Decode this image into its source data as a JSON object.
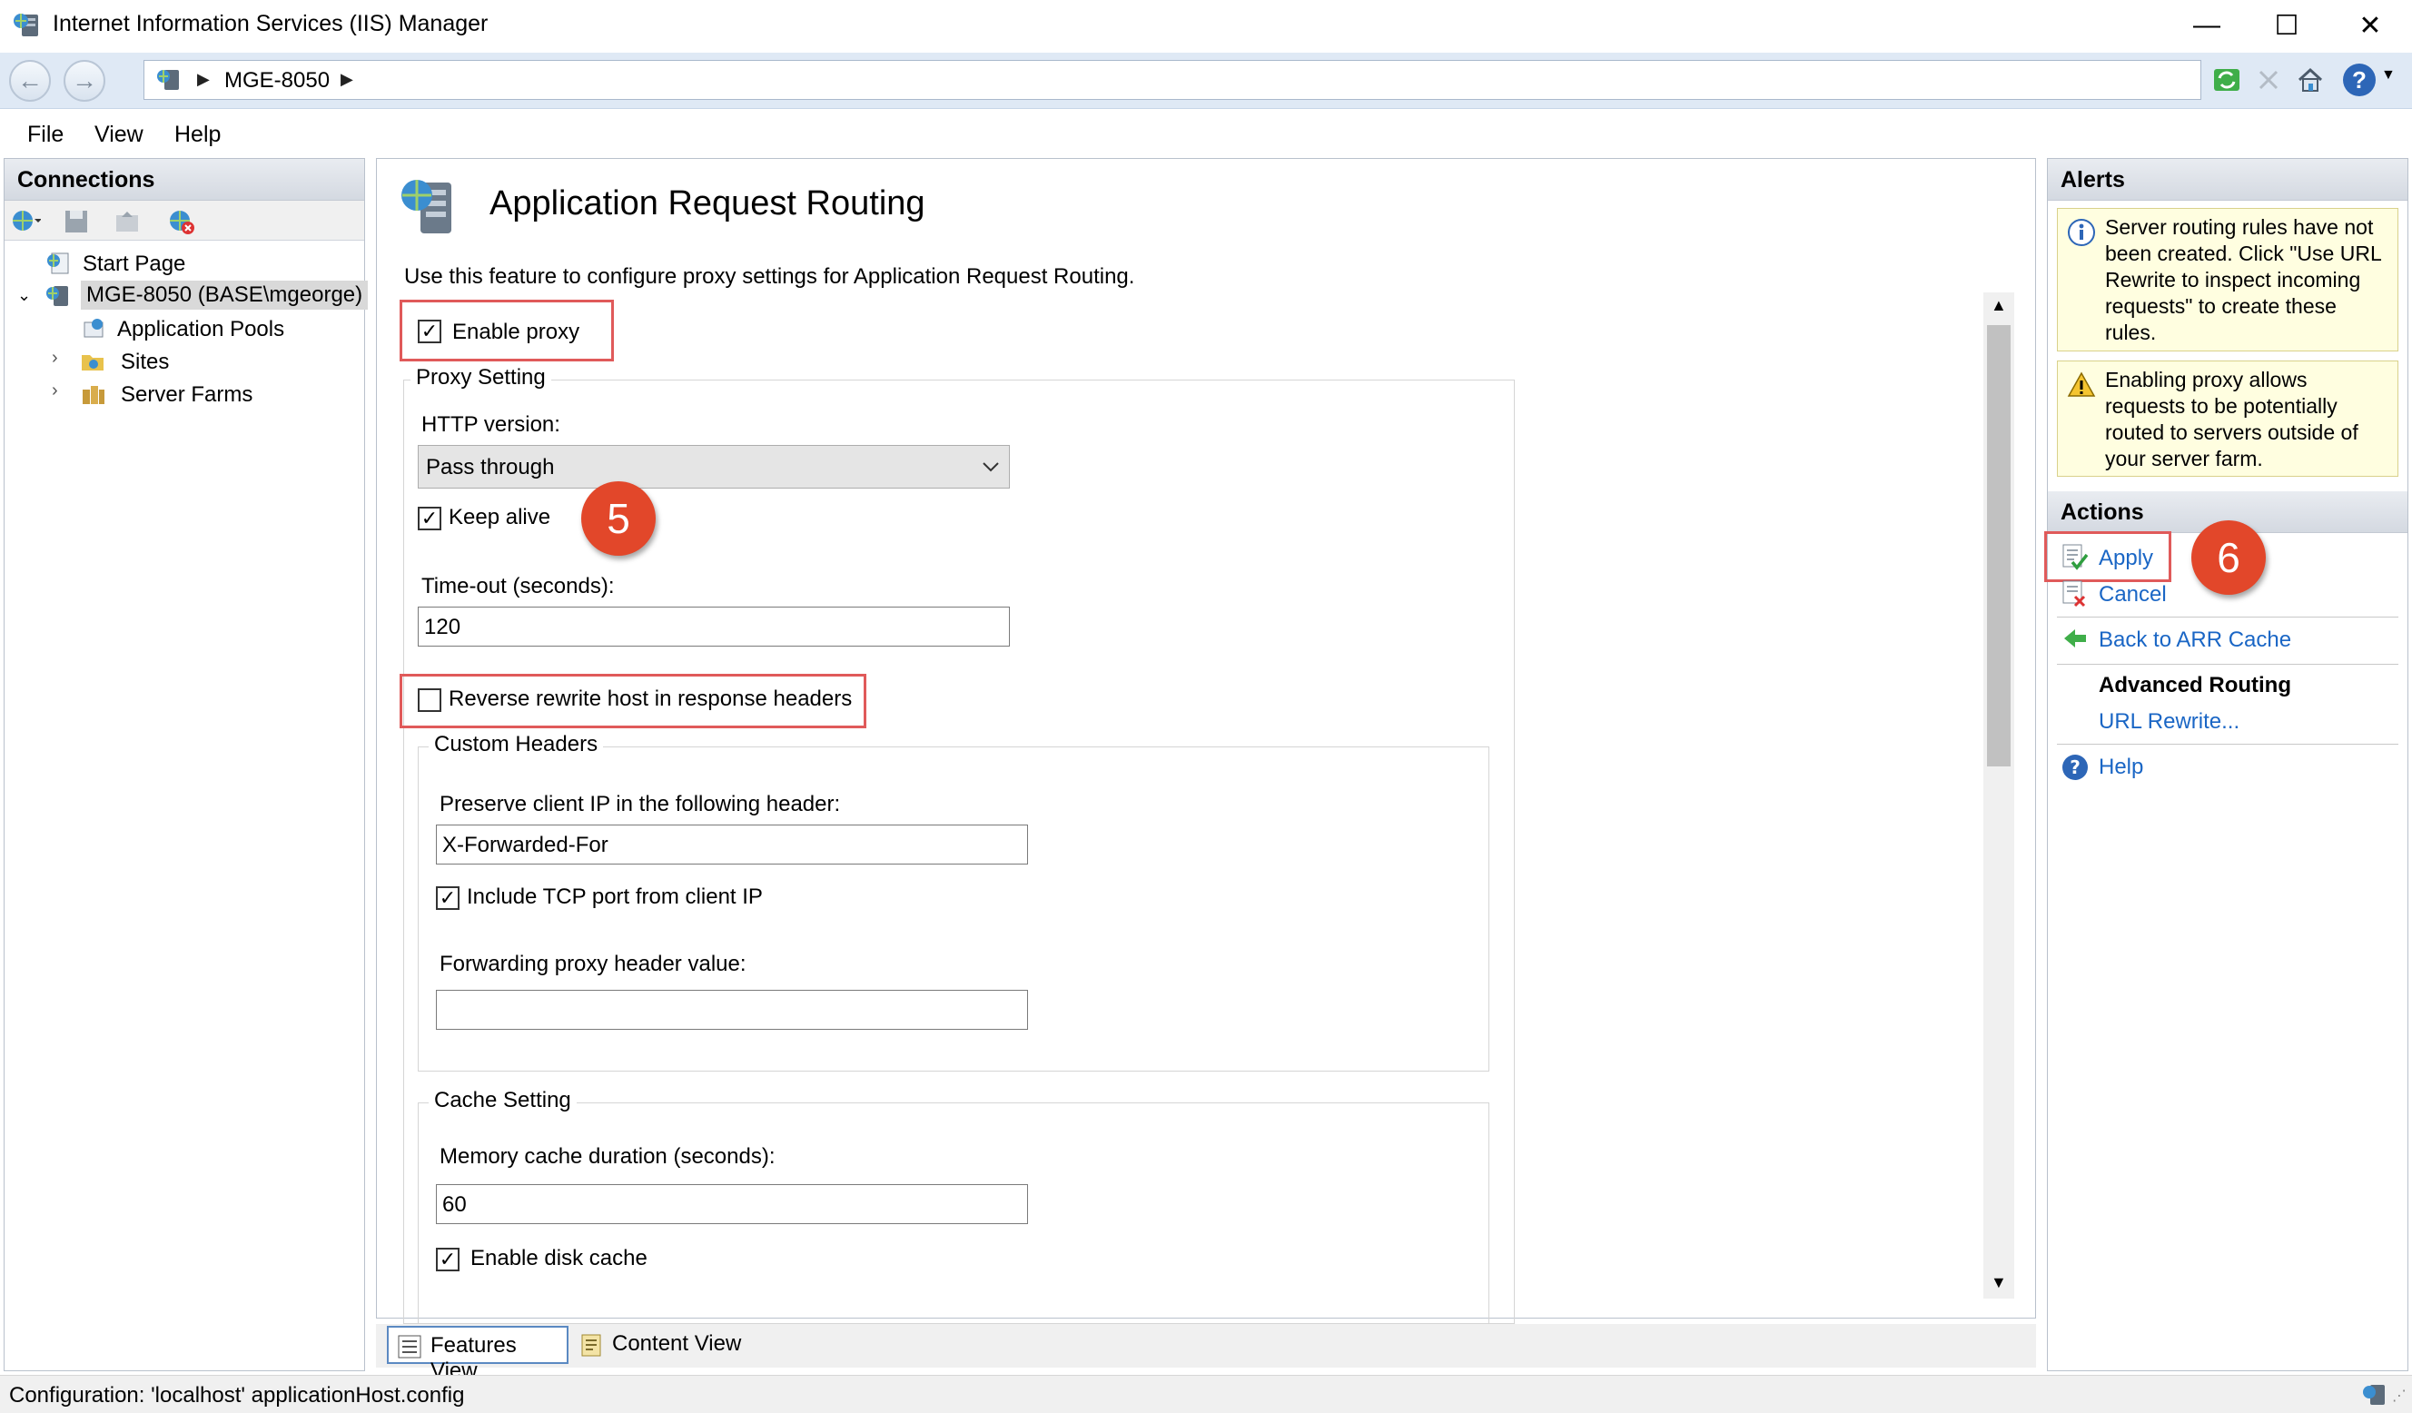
{
  "window": {
    "title": "Internet Information Services (IIS) Manager",
    "controls": {
      "minimize": "—",
      "maximize": "☐",
      "close": "✕"
    }
  },
  "address": {
    "back": "←",
    "forward": "→",
    "path": "MGE-8050",
    "separator": "▶",
    "help": "?"
  },
  "menu": [
    "File",
    "View",
    "Help"
  ],
  "connections": {
    "title": "Connections",
    "tree": [
      {
        "label": "Start Page"
      },
      {
        "label": "MGE-8050 (BASE\\mgeorge)"
      },
      {
        "label": "Application Pools"
      },
      {
        "label": "Sites"
      },
      {
        "label": "Server Farms"
      }
    ]
  },
  "feature": {
    "title": "Application Request Routing",
    "description": "Use this feature to configure proxy settings for Application Request Routing.",
    "enable_proxy": {
      "label": "Enable proxy",
      "checked": true
    },
    "proxy_setting": {
      "title": "Proxy Setting",
      "http_version_label": "HTTP version:",
      "http_version_value": "Pass through",
      "keep_alive": {
        "label": "Keep alive",
        "checked": true
      },
      "timeout_label": "Time-out (seconds):",
      "timeout_value": "120",
      "reverse_rewrite": {
        "label": "Reverse rewrite host in response headers",
        "checked": false
      }
    },
    "custom_headers": {
      "title": "Custom Headers",
      "preserve_ip_label": "Preserve client IP in the following header:",
      "preserve_ip_value": "X-Forwarded-For",
      "include_tcp": {
        "label": "Include TCP port from client IP",
        "checked": true
      },
      "forwarding_label": "Forwarding proxy header value:",
      "forwarding_value": ""
    },
    "cache_setting": {
      "title": "Cache Setting",
      "memory_label": "Memory cache duration (seconds):",
      "memory_value": "60",
      "disk_cache": {
        "label": "Enable disk cache",
        "checked": true
      }
    },
    "badges": {
      "step5": "5",
      "step6": "6"
    }
  },
  "view_tabs": {
    "features": "Features View",
    "content": "Content View"
  },
  "alerts": {
    "title": "Alerts",
    "items": [
      {
        "type": "info",
        "text": "Server routing rules have not been created. Click \"Use URL Rewrite to inspect incoming requests\" to create these rules."
      },
      {
        "type": "warning",
        "text": "Enabling proxy allows requests to be potentially routed to servers outside of your server farm."
      }
    ]
  },
  "actions": {
    "title": "Actions",
    "apply": "Apply",
    "cancel": "Cancel",
    "back": "Back to ARR Cache",
    "advanced_heading": "Advanced Routing",
    "url_rewrite": "URL Rewrite...",
    "help": "Help"
  },
  "status": {
    "text": "Configuration: 'localhost' applicationHost.config"
  },
  "colors": {
    "accent": "#1a66c5",
    "highlight": "#e05a5a",
    "badge": "#e2472a"
  }
}
